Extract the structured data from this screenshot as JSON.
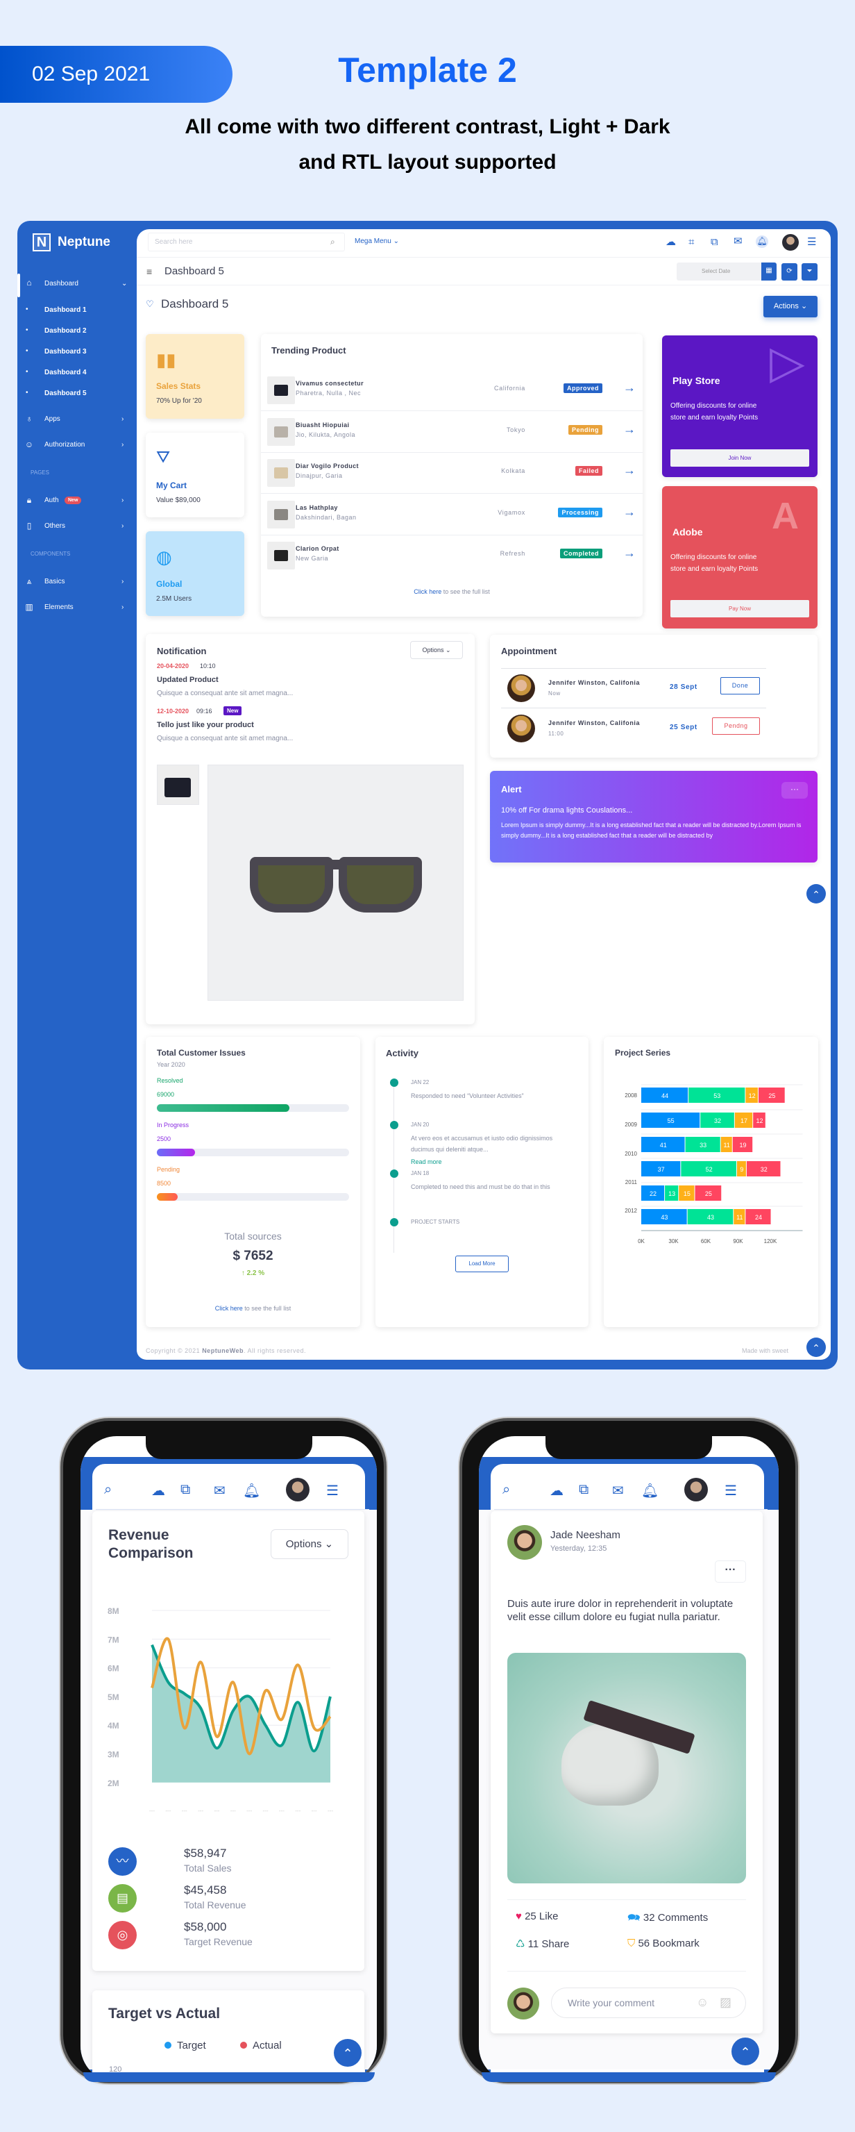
{
  "banner": {
    "date": "02 Sep 2021",
    "title": "Template 2",
    "subtitle_line1": "All come with two different contrast, Light + Dark",
    "subtitle_line2": "and RTL layout supported"
  },
  "colors": {
    "primary": "#2563c7",
    "accent_title": "#1565f5",
    "background": "#e6effd",
    "purple": "#5b17c4",
    "red": "#e5525c",
    "teal": "#0b9e8e"
  },
  "sidebar": {
    "brand": "Neptune",
    "logo_letter": "N",
    "dashboard": {
      "label": "Dashboard",
      "icon": "home-icon",
      "children": [
        "Dashboard 1",
        "Dashboard 2",
        "Dashboard 3",
        "Dashboard 4",
        "Dashboard 5"
      ]
    },
    "apps": {
      "label": "Apps",
      "icon": "lightbulb-icon"
    },
    "authorization": {
      "label": "Authorization",
      "icon": "users-icon"
    },
    "section_pages": "PAGES",
    "auth": {
      "label": "Auth",
      "badge": "New",
      "icon": "lock-icon"
    },
    "others": {
      "label": "Others",
      "icon": "file-icon"
    },
    "section_components": "COMPONENTS",
    "basics": {
      "label": "Basics",
      "icon": "compass-icon"
    },
    "elements": {
      "label": "Elements",
      "icon": "layout-icon"
    }
  },
  "topbar": {
    "search_placeholder": "Search here",
    "mega_menu": "Mega Menu",
    "icons": [
      "weather-icon",
      "fullscreen-exit-icon",
      "translate-icon",
      "mail-icon",
      "bell-icon",
      "avatar",
      "sliders-icon"
    ]
  },
  "subheader": {
    "breadcrumb": "Dashboard 5",
    "date_placeholder": "Select Date"
  },
  "page": {
    "title": "Dashboard 5",
    "actions": "Actions"
  },
  "stats": [
    {
      "title": "Sales Stats",
      "subtitle": "70% Up for '20",
      "icon": "bar-chart-icon"
    },
    {
      "title": "My Cart",
      "subtitle": "Value $89,000",
      "icon": "basket-icon"
    },
    {
      "title": "Global",
      "subtitle": "2.5M Users",
      "icon": "globe-icon"
    }
  ],
  "trending": {
    "title": "Trending Product",
    "footer_link": "Click here",
    "footer_text": " to see the full list",
    "rows": [
      {
        "name": "Vivamus consectetur",
        "sub": "Pharetra, Nulla , Nec",
        "location": "California",
        "status": "Approved",
        "status_color": "#2563c7"
      },
      {
        "name": "Biuasht Hiopuiai",
        "sub": "Jio, Kilukta, Angola",
        "location": "Tokyo",
        "status": "Pending",
        "status_color": "#e9a23b"
      },
      {
        "name": "Diar Vogilo Product",
        "sub": "Dinajpur, Garia",
        "location": "Kolkata",
        "status": "Failed",
        "status_color": "#e5525c"
      },
      {
        "name": "Las Hathplay",
        "sub": "Dakshindari, Bagan",
        "location": "Vigamox",
        "status": "Processing",
        "status_color": "#1e9bf0"
      },
      {
        "name": "Clarion Orpat",
        "sub": "New Garia",
        "location": "Refresh",
        "status": "Completed",
        "status_color": "#0b9e7a"
      }
    ]
  },
  "promos": [
    {
      "title": "Play Store",
      "text": "Offering discounts for online store and earn loyalty Points",
      "button": "Join Now",
      "color": "#5b17c4"
    },
    {
      "title": "Adobe",
      "text": "Offering discounts for online store and earn loyalty Points",
      "button": "Pay Now",
      "color": "#e5525c"
    }
  ],
  "notification": {
    "title": "Notification",
    "options": "Options",
    "items": [
      {
        "date": "20-04-2020",
        "time": "10:10",
        "title": "Updated Product",
        "text": "Quisque a consequat ante sit amet magna..."
      },
      {
        "date": "12-10-2020",
        "time": "09:16",
        "badge": "New",
        "title": "Tello just like your product",
        "text": "Quisque a consequat ante sit amet magna..."
      }
    ]
  },
  "appointment": {
    "title": "Appointment",
    "rows": [
      {
        "name": "Jennifer Winston, Califonia",
        "sub": "Now",
        "date": "28 Sept",
        "action": "Done"
      },
      {
        "name": "Jennifer Winston, Califonia",
        "sub": "11:00",
        "date": "25 Sept",
        "action": "Pendng"
      }
    ]
  },
  "alert": {
    "title": "Alert",
    "headline": "10% off For drama lights Couslations...",
    "text": "Lorem Ipsum is simply dummy...It is a long established fact that a reader will be distracted by.Lorem Ipsum is simply dummy...It is a long established fact that a reader will be distracted by"
  },
  "issues": {
    "title": "Total Customer Issues",
    "year": "Year 2020",
    "items": [
      {
        "label": "Resolved",
        "value": "69000",
        "fraction": 0.69,
        "color": "#16a56b"
      },
      {
        "label": "In Progress",
        "value": "2500",
        "fraction": 0.2,
        "color": "#8a2be2"
      },
      {
        "label": "Pending",
        "value": "8500",
        "fraction": 0.11,
        "color": "#f0883a"
      }
    ],
    "total_label": "Total sources",
    "total_value": "$ 7652",
    "change": "2.2 %",
    "footer_link": "Click here",
    "footer_text": " to see the full list"
  },
  "activity": {
    "title": "Activity",
    "load_more": "Load More",
    "items": [
      {
        "date": "JAN 22",
        "text": "Responded to need “Volunteer Activities”"
      },
      {
        "date": "JAN 20",
        "text": "At vero eos et accusamus et iusto odio dignissimos ducimus qui deleniti atque...",
        "link": "Read more"
      },
      {
        "date": "JAN 18",
        "text": "Completed to need this and must be do that in this"
      },
      {
        "date": "PROJECT STARTS",
        "text": ""
      }
    ]
  },
  "footer": {
    "copyright_prefix": "Copyright © 2021 ",
    "brand": "NeptuneWeb",
    "copyright_suffix": ". All rights reserved.",
    "right": "Made with sweet"
  },
  "chart_data": [
    {
      "type": "bar",
      "orientation": "horizontal",
      "stacked": true,
      "title": "Project Series",
      "y_tick_labels": [
        "2008",
        "2009",
        "2010",
        "2011",
        "2012"
      ],
      "x_ticks": [
        "0K",
        "30K",
        "60K",
        "90K",
        "120K"
      ],
      "xlim": [
        0,
        150
      ],
      "series": [
        {
          "color": "#008ffb",
          "values": [
            44,
            55,
            41,
            37,
            22,
            43
          ]
        },
        {
          "color": "#00e396",
          "values": [
            53,
            32,
            33,
            52,
            13,
            43
          ]
        },
        {
          "color": "#feb019",
          "values": [
            12,
            17,
            11,
            9,
            15,
            11
          ]
        },
        {
          "color": "#ff4560",
          "values": [
            25,
            12,
            19,
            32,
            25,
            24
          ]
        }
      ]
    },
    {
      "type": "line",
      "title": "Revenue Comparison",
      "options": "Options",
      "y_ticks": [
        "8M",
        "7M",
        "6M",
        "5M",
        "4M",
        "3M",
        "2M"
      ],
      "ylim": [
        2,
        8
      ],
      "x_tick_labels": [
        "---",
        "---",
        "---",
        "---",
        "---",
        "---",
        "---",
        "---",
        "---",
        "---",
        "---",
        "---"
      ],
      "series": [
        {
          "color": "#0b9e8e",
          "fill": "#9fd5ce",
          "values": [
            6.8,
            5.5,
            5.1,
            4.6,
            3.2,
            4.5,
            5.0,
            4.0,
            3.3,
            4.8,
            3.1,
            5.0
          ]
        },
        {
          "color": "#e9a23b",
          "values": [
            5.3,
            7.0,
            3.9,
            6.2,
            3.6,
            5.5,
            3.0,
            5.2,
            4.2,
            6.1,
            3.9,
            4.3
          ]
        }
      ]
    }
  ],
  "phone_left": {
    "stats": [
      {
        "value": "$58,947",
        "label": "Total Sales",
        "color": "#2563c7",
        "icon": "wave-chart-icon"
      },
      {
        "value": "$45,458",
        "label": "Total Revenue",
        "color": "#7ab648",
        "icon": "invoice-dollar-icon"
      },
      {
        "value": "$58,000",
        "label": "Target Revenue",
        "color": "#e5525c",
        "icon": "target-icon"
      }
    ],
    "target_title": "Target vs Actual",
    "legend": [
      {
        "name": "Target",
        "color": "#1e9bf0"
      },
      {
        "name": "Actual",
        "color": "#e5525c"
      }
    ],
    "partial_tick": "120"
  },
  "phone_right": {
    "author": "Jade Neesham",
    "time": "Yesterday, 12:35",
    "text": "Duis aute irure dolor in reprehenderit in voluptate velit esse cillum dolore eu fugiat nulla pariatur.",
    "likes": "25 Like",
    "comments": "32 Comments",
    "shares": "11 Share",
    "bookmarks": "56 Bookmark",
    "comment_placeholder": "Write your comment"
  }
}
